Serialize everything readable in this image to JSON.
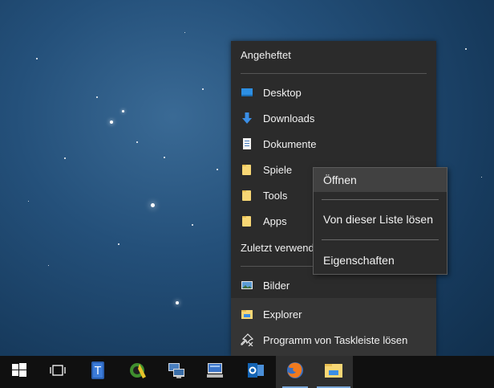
{
  "jumplist": {
    "pinned_header": "Angeheftet",
    "pinned": [
      {
        "label": "Desktop",
        "icon": "desktop-icon"
      },
      {
        "label": "Downloads",
        "icon": "download-arrow-icon"
      },
      {
        "label": "Dokumente",
        "icon": "document-icon"
      },
      {
        "label": "Spiele",
        "icon": "folder-icon"
      },
      {
        "label": "Tools",
        "icon": "folder-icon"
      },
      {
        "label": "Apps",
        "icon": "folder-icon"
      }
    ],
    "recent_header": "Zuletzt verwende",
    "recent": [
      {
        "label": "Bilder",
        "icon": "pictures-icon"
      }
    ],
    "tasks": [
      {
        "label": "Explorer",
        "icon": "file-explorer-icon"
      },
      {
        "label": "Programm von Taskleiste lösen",
        "icon": "unpin-icon"
      }
    ]
  },
  "context_menu": {
    "items": [
      "Öffnen",
      "Von dieser Liste lösen",
      "Eigenschaften"
    ]
  },
  "taskbar": {
    "items": [
      "windows-start-icon",
      "task-view-icon",
      "tools-app-icon",
      "green-app-icon",
      "network-computer-icon",
      "remote-desktop-icon",
      "outlook-icon",
      "firefox-icon",
      "file-explorer-icon"
    ]
  },
  "colors": {
    "menu_bg": "#2b2b2b",
    "taskbar_bg": "#101010",
    "folder": "#f8d775",
    "accent": "#7aa7d8"
  }
}
